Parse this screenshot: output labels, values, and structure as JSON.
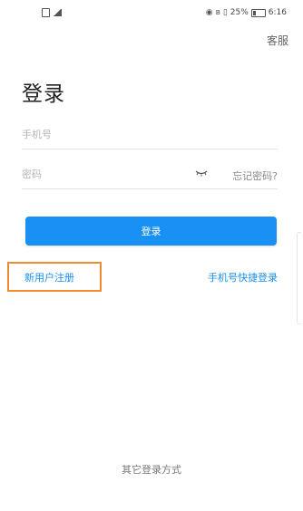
{
  "status_bar": {
    "indicators": "25%",
    "time": "6:16"
  },
  "header": {
    "help_label": "客服"
  },
  "login": {
    "title": "登录",
    "phone_placeholder": "手机号",
    "password_placeholder": "密码",
    "forgot_label": "忘记密码?",
    "submit_label": "登录",
    "register_label": "新用户注册",
    "quick_login_label": "手机号快捷登录",
    "other_methods_label": "其它登录方式"
  },
  "colors": {
    "accent": "#1890f4",
    "highlight": "#f28a30"
  },
  "icons": [
    "sim-icon",
    "signal-icon",
    "eye-icon",
    "bluetooth-icon",
    "vibrate-icon",
    "battery-icon",
    "password-visibility-icon"
  ]
}
